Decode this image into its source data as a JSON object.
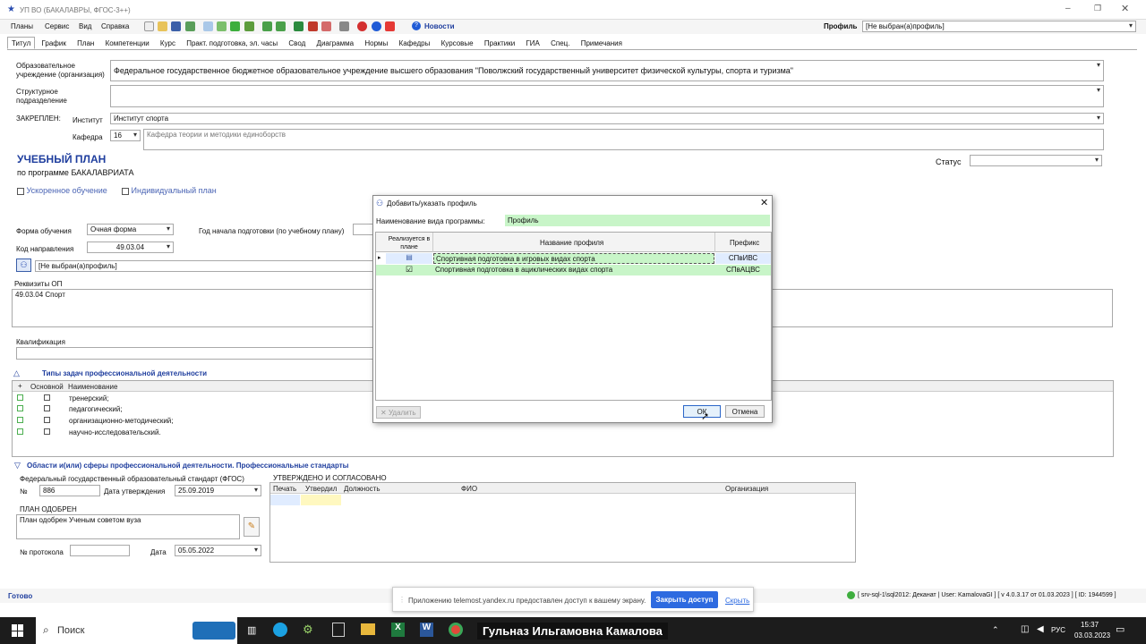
{
  "window": {
    "title": "УП ВО (БАКАЛАВРЫ, ФГОС-3++)"
  },
  "menu": [
    "Планы",
    "Сервис",
    "Вид",
    "Справка"
  ],
  "news_label": "Новости",
  "profile": {
    "label": "Профиль",
    "value": "[Не выбран(а)профиль]"
  },
  "tabs": [
    "Титул",
    "График",
    "План",
    "Компетенции",
    "Курс",
    "Практ. подготовка, эл. часы",
    "Свод",
    "Диаграмма",
    "Нормы",
    "Кафедры",
    "Курсовые",
    "Практики",
    "ГИА",
    "Спец.",
    "Примечания"
  ],
  "org": {
    "label": "Образовательное учреждение (организация)",
    "value": "Федеральное государственное бюджетное образовательное учреждение высшего образования \"Поволжский государственный университет физической культуры, спорта и туризма\"",
    "struct_label": "Структурное подразделение",
    "zakrep_label": "ЗАКРЕПЛЕН:",
    "institut_label": "Институт",
    "institut_value": "Институт спорта",
    "kafedra_label": "Кафедра",
    "kafedra_num": "16",
    "kafedra_value": "Кафедра теории и методики единоборств"
  },
  "plan": {
    "title": "УЧЕБНЫЙ ПЛАН",
    "subtitle": "по программе БАКАЛАВРИАТА",
    "accel_label": "Ускоренное обучение",
    "individ_label": "Индивидуальный план",
    "status_label": "Статус",
    "forma_label": "Форма обучения",
    "forma_value": "Очная форма",
    "god_label": "Год начала подготовки (по учебному плану)",
    "kod_label": "Код направления",
    "kod_value": "49.03.04",
    "profile_value": "[Не выбран(а)профиль]",
    "rekv_label": "Реквизиты ОП",
    "rekv_value": "49.03.04 Спорт",
    "kval_label": "Квалификация"
  },
  "tasks": {
    "title": "Типы задач профессиональной деятельности",
    "col_plus": "+",
    "col_main": "Основной",
    "col_name": "Наименование",
    "rows": [
      "тренерский;",
      "педагогический;",
      "организационно-методический;",
      "научно-исследовательский."
    ]
  },
  "areas": {
    "title": "Области и(или) сферы профессиональной деятельности. Профессиональные стандарты",
    "fgos_label": "Федеральный государственный образовательный стандарт (ФГОС)",
    "num_label": "№",
    "num_value": "886",
    "date_label": "Дата утверждения",
    "date_value": "25.09.2019",
    "approved_label": "ПЛАН ОДОБРЕН",
    "approved_value": "План одобрен Ученым советом вуза",
    "protocol_label": "№ протокола",
    "date2_label": "Дата",
    "date2_value": "05.05.2022"
  },
  "signatures": {
    "title": "УТВЕРЖДЕНО И СОГЛАСОВАНО",
    "cols": [
      "Печать",
      "Утвердил",
      "Должность",
      "ФИО",
      "Организация"
    ]
  },
  "dialog": {
    "title": "Добавить/указать профиль",
    "type_label": "Наименование вида программы:",
    "type_value": "Профиль",
    "col_realized": "Реализуется в плане",
    "col_name": "Название профиля",
    "col_prefix": "Префикс",
    "rows": [
      {
        "name": "Спортивная подготовка в игровых видах спорта",
        "prefix": "СПвИВС",
        "checked": false
      },
      {
        "name": "Спортивная подготовка в ациклических видах спорта",
        "prefix": "СПвАЦВС",
        "checked": true
      }
    ],
    "delete_label": "Удалить",
    "ok_label": "ОК",
    "cancel_label": "Отмена"
  },
  "status": {
    "ready": "Готово",
    "info": "[ srv-sql-1\\sql2012: Деканат | User: KamalovaGI ] [ v 4.0.3.17 от 01.03.2023 ] [ ID: 1944599 ]"
  },
  "share_bar": {
    "text": "Приложению telemost.yandex.ru предоставлен доступ к вашему экрану.",
    "close_btn": "Закрыть доступ",
    "hide_link": "Скрыть"
  },
  "taskbar": {
    "search": "Поиск",
    "user_name": "Гульназ Ильгамовна Камалова",
    "lang": "РУС",
    "time": "15:37",
    "date": "03.03.2023"
  },
  "colors": {
    "green_field": "#c8f5c8",
    "accent_blue": "#1f3e9e",
    "taskbar": "#1c1c1c"
  }
}
